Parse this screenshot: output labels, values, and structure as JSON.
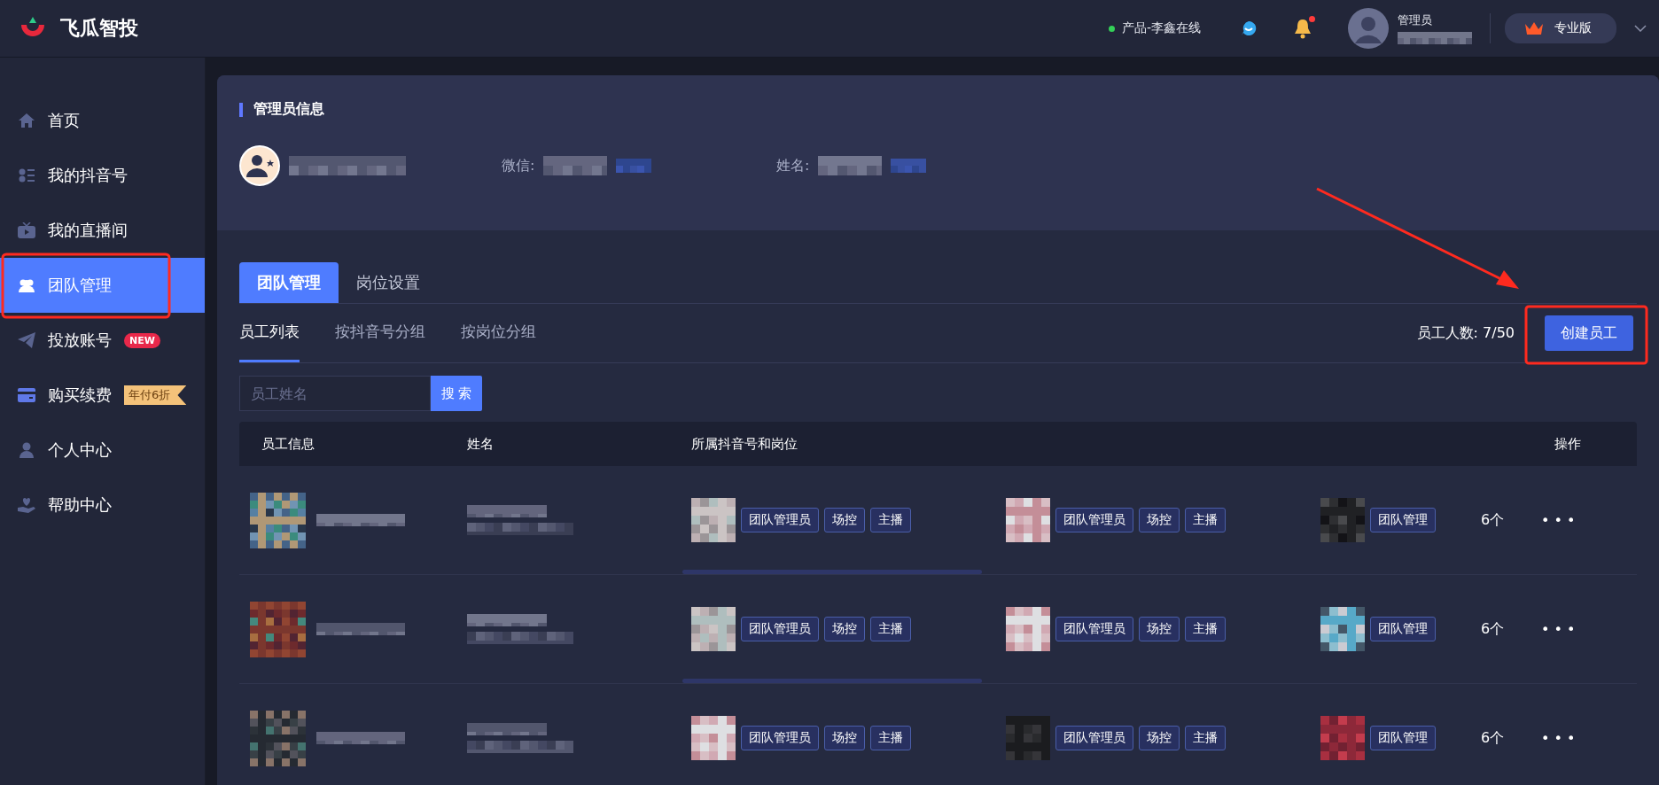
{
  "top_bar": {
    "brand": "飞瓜智投",
    "status": {
      "text": "产品-李鑫在线",
      "online": true
    },
    "notifications": {
      "unread": true
    },
    "user": {
      "role": "管理员"
    },
    "plan": "专业版"
  },
  "sidebar": {
    "items": [
      {
        "label": "首页",
        "kind": "home",
        "selected": false
      },
      {
        "label": "我的抖音号",
        "kind": "list",
        "selected": false
      },
      {
        "label": "我的直播间",
        "kind": "tv",
        "selected": false
      },
      {
        "label": "团队管理",
        "kind": "team",
        "selected": true
      },
      {
        "label": "投放账号",
        "kind": "plane",
        "selected": false,
        "badge": {
          "text": "NEW",
          "kind": "new"
        }
      },
      {
        "label": "购买续费",
        "kind": "card",
        "selected": false,
        "badge": {
          "text": "年付6折",
          "kind": "promo"
        }
      },
      {
        "label": "个人中心",
        "kind": "person",
        "selected": false
      },
      {
        "label": "帮助中心",
        "kind": "help",
        "selected": false
      }
    ]
  },
  "admin_info": {
    "title": "管理员信息",
    "fields": [
      {
        "label": "微信:"
      },
      {
        "label": "姓名:"
      }
    ]
  },
  "tabs": [
    {
      "label": "团队管理",
      "selected": true
    },
    {
      "label": "岗位设置",
      "selected": false
    }
  ],
  "sub_tabs": [
    {
      "label": "员工列表",
      "selected": true
    },
    {
      "label": "按抖音号分组",
      "selected": false
    },
    {
      "label": "按岗位分组",
      "selected": false
    }
  ],
  "employee_count": {
    "label": "员工人数:",
    "value": "7/50"
  },
  "create_button": "创建员工",
  "search": {
    "placeholder": "员工姓名",
    "button": "搜 索"
  },
  "table": {
    "columns": [
      "员工信息",
      "姓名",
      "所属抖音号和岗位",
      "操作"
    ],
    "rows": [
      {
        "accounts": [
          {
            "roles": [
              "团队管理员",
              "场控",
              "主播"
            ]
          },
          {
            "roles": [
              "团队管理员",
              "场控",
              "主播"
            ]
          },
          {
            "roles": [
              "团队管理"
            ]
          }
        ],
        "count": "6个",
        "menu": "• • •"
      },
      {
        "accounts": [
          {
            "roles": [
              "团队管理员",
              "场控",
              "主播"
            ]
          },
          {
            "roles": [
              "团队管理员",
              "场控",
              "主播"
            ]
          },
          {
            "roles": [
              "团队管理"
            ]
          }
        ],
        "count": "6个",
        "menu": "• • •"
      },
      {
        "accounts": [
          {
            "roles": [
              "团队管理员",
              "场控",
              "主播"
            ]
          },
          {
            "roles": [
              "团队管理员",
              "场控",
              "主播"
            ]
          },
          {
            "roles": [
              "团队管理"
            ]
          }
        ],
        "count": "6个",
        "menu": "• • •"
      }
    ]
  }
}
